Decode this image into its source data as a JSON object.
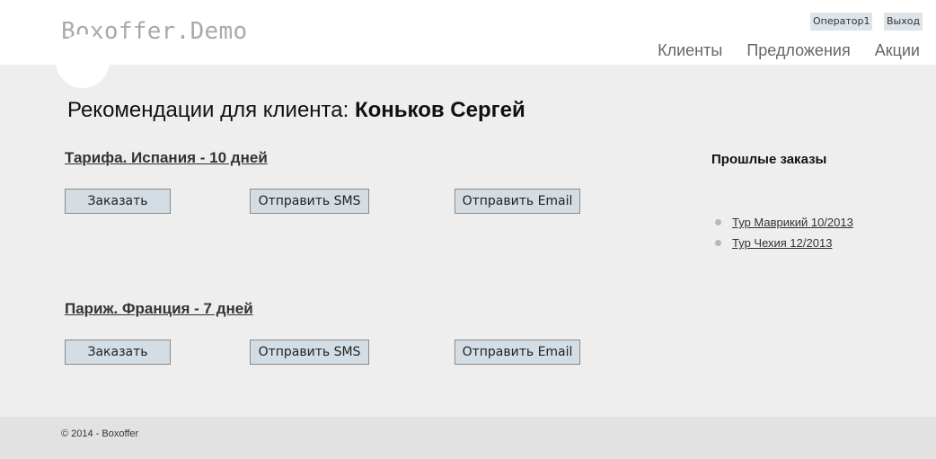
{
  "header": {
    "logo": "Boxoffer.Demo",
    "user_label": "Оператор1",
    "logout_label": "Выход",
    "nav": [
      {
        "label": "Клиенты"
      },
      {
        "label": "Предложения"
      },
      {
        "label": "Акции"
      }
    ]
  },
  "main": {
    "title_prefix": "Рекомендации для клиента:",
    "client_name": "Коньков Сергей",
    "offers": [
      {
        "title": "Тарифа. Испания - 10 дней",
        "order_label": "Заказать",
        "sms_label": "Отправить SMS",
        "email_label": "Отправить Email"
      },
      {
        "title": "Париж. Франция - 7 дней",
        "order_label": "Заказать",
        "sms_label": "Отправить SMS",
        "email_label": "Отправить Email"
      }
    ]
  },
  "past_orders": {
    "title": "Прошлые заказы",
    "items": [
      {
        "label": "Тур Маврикий 10/2013"
      },
      {
        "label": "Тур Чехия 12/2013"
      }
    ]
  },
  "footer": {
    "copyright": "© 2014 - Boxoffer"
  },
  "colors": {
    "main_bg": "#eeeeee",
    "footer_bg": "#e2e2e2",
    "button_bg": "#d3dde3",
    "logo_color": "#a9a9a9"
  }
}
